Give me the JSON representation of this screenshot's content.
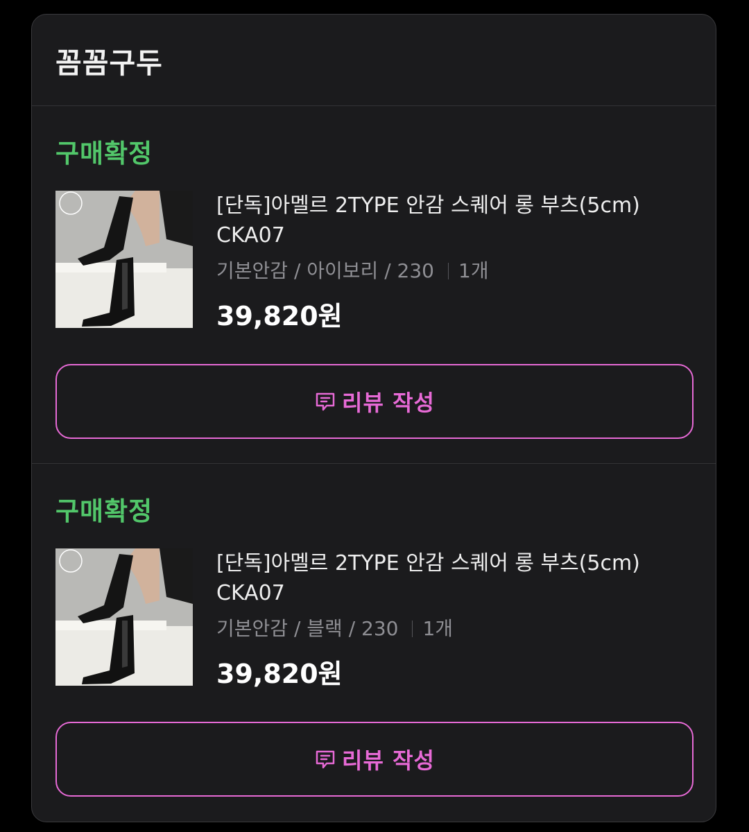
{
  "store": {
    "name": "꼼꼼구두"
  },
  "orders": [
    {
      "status": "구매확정",
      "product_name_line1": "[단독]아멜르 2TYPE 안감 스퀘어 롱 부츠(5cm)",
      "product_name_line2": "CKA07",
      "option": "기본안감 / 아이보리 / 230",
      "quantity": "1개",
      "price": "39,820원",
      "review_label": "리뷰 작성",
      "thumbnail_icon": "boots-product-photo"
    },
    {
      "status": "구매확정",
      "product_name_line1": "[단독]아멜르 2TYPE 안감 스퀘어 롱 부츠(5cm)",
      "product_name_line2": "CKA07",
      "option": "기본안감 / 블랙 / 230",
      "quantity": "1개",
      "price": "39,820원",
      "review_label": "리뷰 작성",
      "thumbnail_icon": "boots-product-photo"
    }
  ],
  "colors": {
    "background": "#000000",
    "card": "#1b1b1d",
    "status_green": "#52c76a",
    "accent_pink": "#e76ad6",
    "text_primary": "#eeeeee",
    "text_secondary": "#8f8f94"
  },
  "icons": {
    "review": "chat-bubble-lines-icon"
  }
}
